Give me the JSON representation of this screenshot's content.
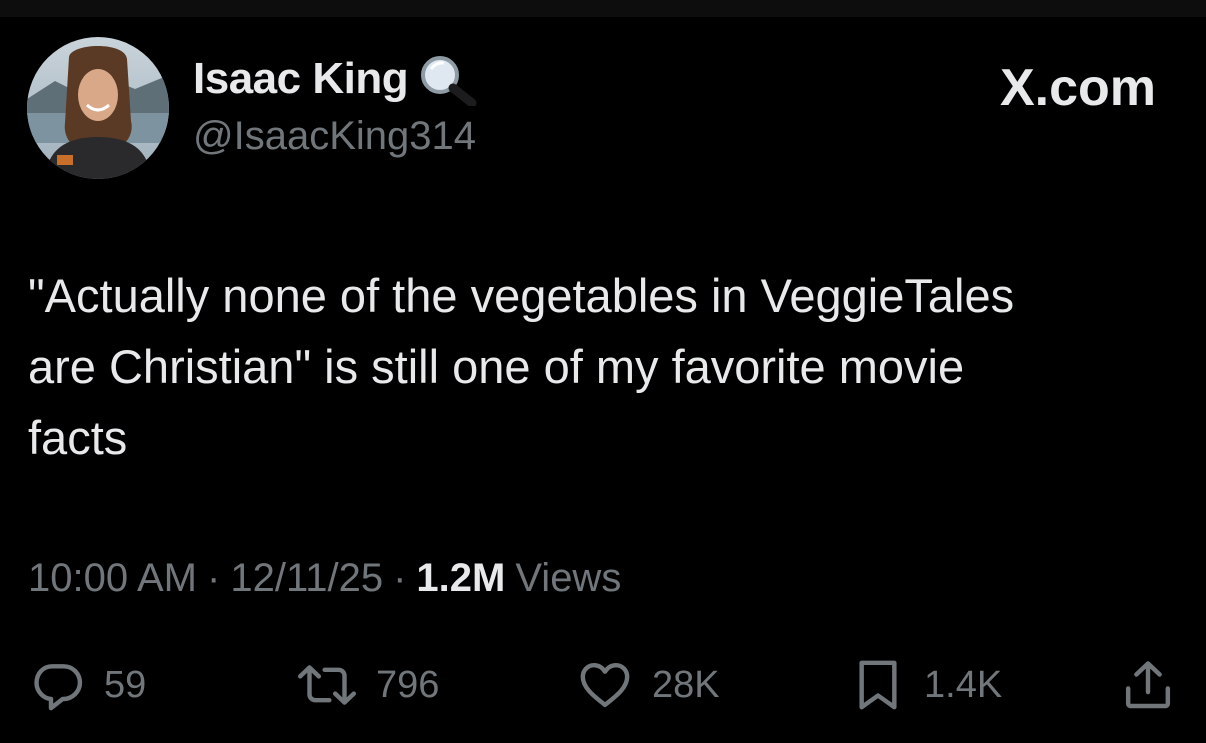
{
  "author": {
    "display_name": "Isaac King",
    "handle": "@IsaacKing314",
    "badge_icon": "magnifying-glass-emoji"
  },
  "site": {
    "logo_text": "X.com"
  },
  "tweet": {
    "text": "\"Actually none of the vegetables in VeggieTales\nare Christian\" is still one of my favorite movie\nfacts",
    "time": "10:00 AM",
    "date": "12/11/25",
    "separator": "·",
    "views_count": "1.2M",
    "views_label": "Views"
  },
  "actions": {
    "replies": "59",
    "retweets": "796",
    "likes": "28K",
    "bookmarks": "1.4K"
  },
  "colors": {
    "background": "#000000",
    "text_primary": "#e7e9ea",
    "text_secondary": "#71767b"
  }
}
